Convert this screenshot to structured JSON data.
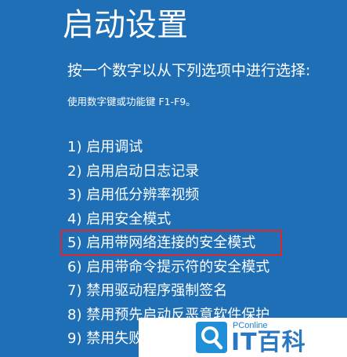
{
  "colors": {
    "background": "#1E6FB5",
    "text": "#FFFFFF",
    "highlight_border": "#E0242A",
    "watermark_blue": "#2B78C2"
  },
  "screen": {
    "title": "启动设置",
    "prompt": "按一个数字以从下列选项中进行选择:",
    "hint": "使用数字键或功能键 F1-F9。",
    "options": [
      "1) 启用调试",
      "2) 启用启动日志记录",
      "3) 启用低分辨率视频",
      "4) 启用安全模式",
      "5) 启用带网络连接的安全模式",
      "6) 启用带命令提示符的安全模式",
      "7) 禁用驱动程序强制签名",
      "8) 禁用预先启动反恶意软件保护",
      "9) 禁用失败后自动重新启动"
    ],
    "highlighted_option": "5) 启用带网络连接的安全模式"
  },
  "watermark": {
    "brand_small": "PConline",
    "brand_big": "IT百科",
    "icon": "magnifier-logo-icon"
  }
}
